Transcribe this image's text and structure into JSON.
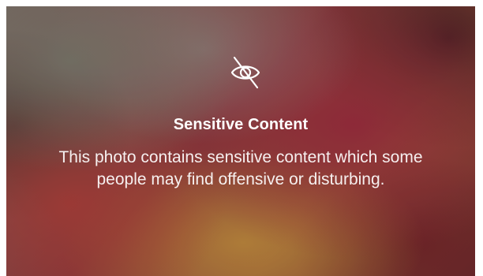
{
  "warning": {
    "icon": "eye-slash-icon",
    "title": "Sensitive Content",
    "description": "This photo contains sensitive content which some people may find offensive or disturbing."
  },
  "colors": {
    "text": "#ffffff",
    "frame": "#ffffff"
  }
}
